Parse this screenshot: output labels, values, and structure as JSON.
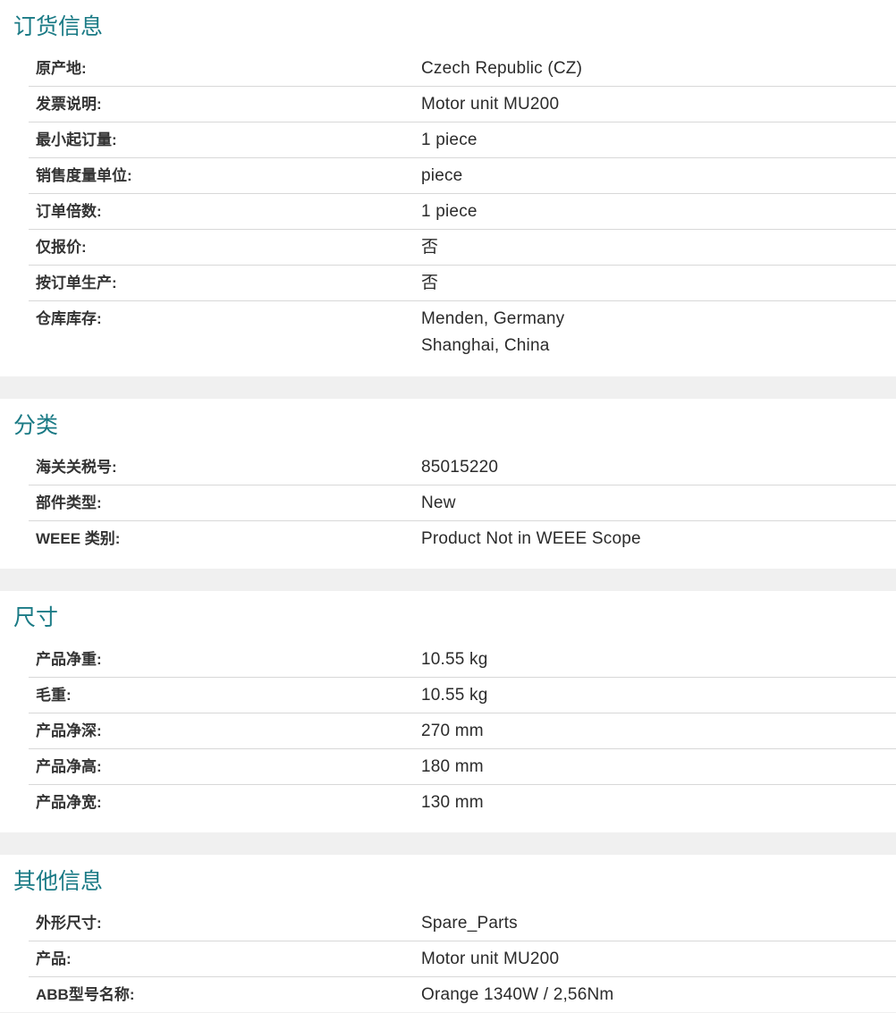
{
  "sections": [
    {
      "title": "订货信息",
      "rows": [
        {
          "label": "原产地:",
          "values": [
            "Czech Republic (CZ)"
          ]
        },
        {
          "label": "发票说明:",
          "values": [
            "Motor unit MU200"
          ]
        },
        {
          "label": "最小起订量:",
          "values": [
            "1 piece"
          ]
        },
        {
          "label": "销售度量单位:",
          "values": [
            "piece"
          ]
        },
        {
          "label": "订单倍数:",
          "values": [
            "1 piece"
          ]
        },
        {
          "label": "仅报价:",
          "values": [
            "否"
          ]
        },
        {
          "label": "按订单生产:",
          "values": [
            "否"
          ]
        },
        {
          "label": "仓库库存:",
          "values": [
            "Menden, Germany",
            "Shanghai, China"
          ]
        }
      ]
    },
    {
      "title": "分类",
      "rows": [
        {
          "label": "海关关税号:",
          "values": [
            "85015220"
          ]
        },
        {
          "label": "部件类型:",
          "values": [
            "New"
          ]
        },
        {
          "label": "WEEE 类别:",
          "values": [
            "Product Not in WEEE Scope"
          ]
        }
      ]
    },
    {
      "title": "尺寸",
      "rows": [
        {
          "label": "产品净重:",
          "values": [
            "10.55 kg"
          ]
        },
        {
          "label": "毛重:",
          "values": [
            "10.55 kg"
          ]
        },
        {
          "label": "产品净深:",
          "values": [
            "270 mm"
          ]
        },
        {
          "label": "产品净高:",
          "values": [
            "180 mm"
          ]
        },
        {
          "label": "产品净宽:",
          "values": [
            "130 mm"
          ]
        }
      ]
    },
    {
      "title": "其他信息",
      "rows": [
        {
          "label": "外形尺寸:",
          "values": [
            "Spare_Parts"
          ]
        },
        {
          "label": "产品:",
          "values": [
            "Motor unit MU200"
          ]
        },
        {
          "label": "ABB型号名称:",
          "values": [
            "Orange 1340W / 2,56Nm"
          ]
        }
      ]
    }
  ],
  "colors": {
    "title": "#1a7a85",
    "background": "#f0f0f0",
    "panel": "#ffffff",
    "divider": "#d8d8d8"
  }
}
